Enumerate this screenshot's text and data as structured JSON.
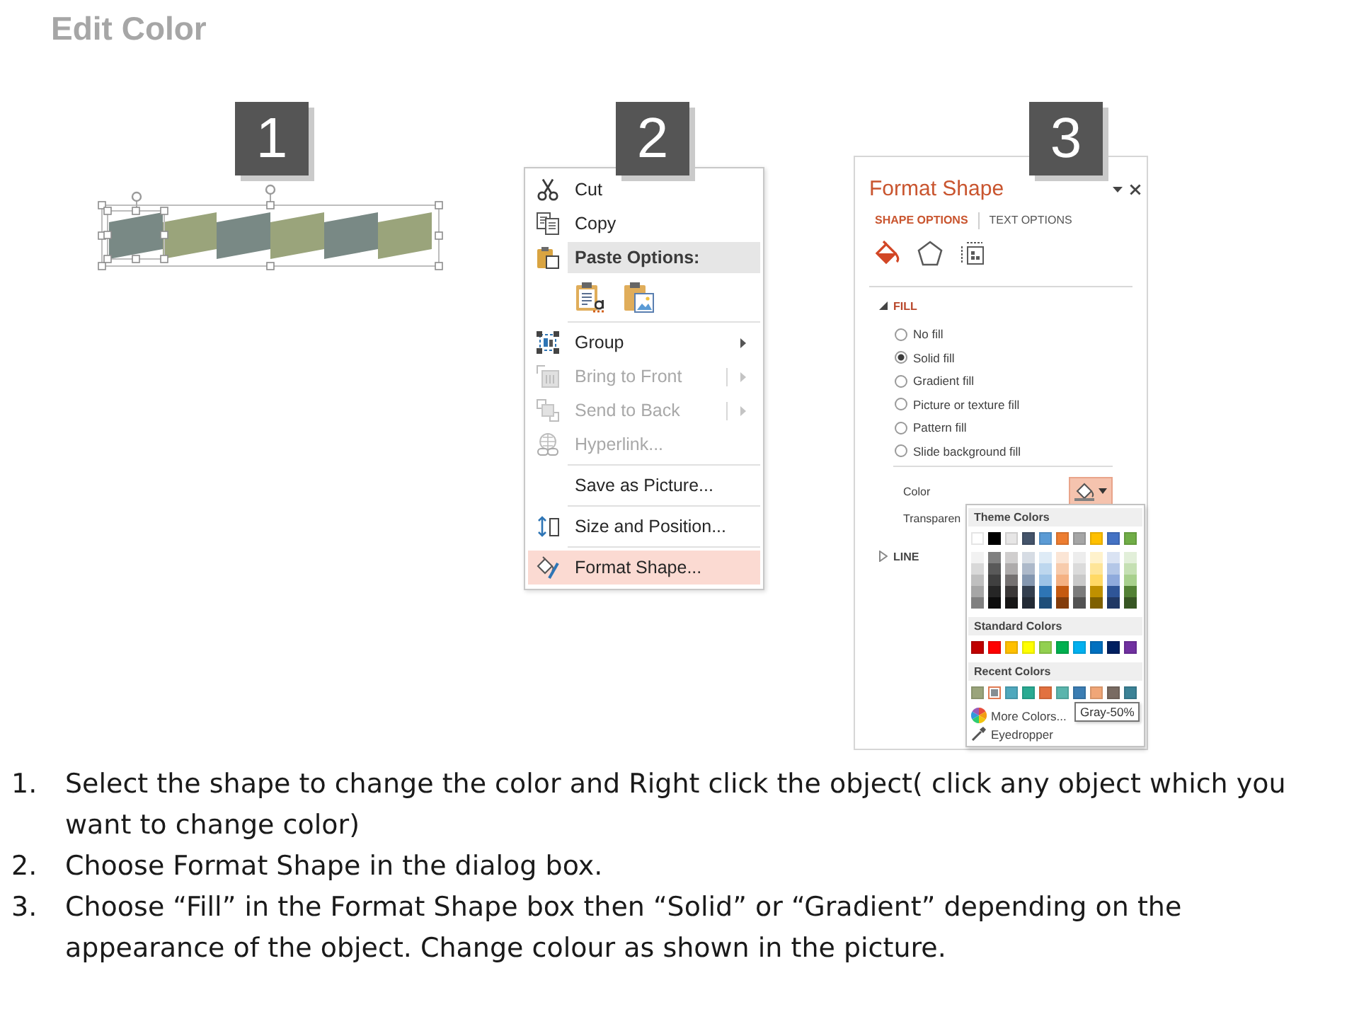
{
  "title": "Edit Color",
  "step_badges": [
    "1",
    "2",
    "3"
  ],
  "shape_group": {
    "selected": true,
    "shapes": [
      {
        "color": "#798985",
        "selected": true
      },
      {
        "color": "#9aa47b",
        "selected": false
      },
      {
        "color": "#798985",
        "selected": false
      },
      {
        "color": "#9aa47b",
        "selected": false
      },
      {
        "color": "#798985",
        "selected": false
      },
      {
        "color": "#9aa47b",
        "selected": false
      }
    ]
  },
  "context_menu": {
    "items": [
      {
        "kind": "command",
        "label": "Cut",
        "disabled": false,
        "submenu": false,
        "split": false,
        "selected": false
      },
      {
        "kind": "command",
        "label": "Copy",
        "disabled": false,
        "submenu": false,
        "split": false,
        "selected": false
      },
      {
        "kind": "header",
        "label": "Paste Options:"
      },
      {
        "kind": "paste_options",
        "options": [
          {
            "selected": false
          },
          {
            "selected": false
          }
        ]
      },
      {
        "kind": "separator"
      },
      {
        "kind": "command",
        "label": "Group",
        "disabled": false,
        "submenu": true,
        "split": false,
        "selected": false
      },
      {
        "kind": "command",
        "label": "Bring to Front",
        "disabled": true,
        "submenu": true,
        "split": true,
        "selected": false
      },
      {
        "kind": "command",
        "label": "Send to Back",
        "disabled": true,
        "submenu": true,
        "split": true,
        "selected": false
      },
      {
        "kind": "command",
        "label": "Hyperlink...",
        "disabled": true,
        "submenu": false,
        "split": false,
        "selected": false
      },
      {
        "kind": "separator"
      },
      {
        "kind": "command",
        "label": "Save as Picture...",
        "disabled": false,
        "submenu": false,
        "split": false,
        "selected": false
      },
      {
        "kind": "separator"
      },
      {
        "kind": "command",
        "label": "Size and Position...",
        "disabled": false,
        "submenu": false,
        "split": false,
        "selected": false
      },
      {
        "kind": "separator"
      },
      {
        "kind": "command",
        "label": "Format Shape...",
        "disabled": false,
        "submenu": false,
        "split": false,
        "selected": true
      }
    ]
  },
  "format_panel": {
    "title": "Format Shape",
    "tabs": [
      {
        "label": "SHAPE OPTIONS",
        "selected": true
      },
      {
        "label": "TEXT OPTIONS",
        "selected": false
      }
    ],
    "icon_tabs": [
      {
        "selected": true
      },
      {
        "selected": false
      },
      {
        "selected": false
      }
    ],
    "sections": [
      {
        "label": "FILL",
        "expanded": true,
        "options": [
          {
            "label": "No fill",
            "checked": false
          },
          {
            "label": "Solid fill",
            "checked": true
          },
          {
            "label": "Gradient fill",
            "checked": false
          },
          {
            "label": "Picture or texture fill",
            "checked": false
          },
          {
            "label": "Pattern fill",
            "checked": false
          },
          {
            "label": "Slide background fill",
            "checked": false
          }
        ],
        "color": {
          "label": "Color",
          "expanded": true
        },
        "transparency": {
          "label": "Transparen"
        }
      },
      {
        "label": "LINE",
        "expanded": false
      }
    ],
    "color_palette": {
      "groups": [
        {
          "title": "Theme Colors",
          "colors": [
            {
              "color": "#ffffff",
              "selected": false,
              "shades": [
                {
                  "color": "#f2f2f2",
                  "selected": false
                },
                {
                  "color": "#d9d9d9",
                  "selected": false
                },
                {
                  "color": "#bfbfbf",
                  "selected": false
                },
                {
                  "color": "#a6a6a6",
                  "selected": false
                },
                {
                  "color": "#808080",
                  "selected": false
                }
              ]
            },
            {
              "color": "#000000",
              "selected": false,
              "shades": [
                {
                  "color": "#7f7f7f",
                  "selected": false
                },
                {
                  "color": "#595959",
                  "selected": false
                },
                {
                  "color": "#404040",
                  "selected": false
                },
                {
                  "color": "#262626",
                  "selected": false
                },
                {
                  "color": "#0d0d0d",
                  "selected": false
                }
              ]
            },
            {
              "color": "#e7e6e6",
              "selected": false,
              "shades": [
                {
                  "color": "#d0cece",
                  "selected": false
                },
                {
                  "color": "#aeabab",
                  "selected": false
                },
                {
                  "color": "#757171",
                  "selected": false
                },
                {
                  "color": "#3b3838",
                  "selected": false
                },
                {
                  "color": "#171616",
                  "selected": false
                }
              ]
            },
            {
              "color": "#44546a",
              "selected": false,
              "shades": [
                {
                  "color": "#d6dce4",
                  "selected": false
                },
                {
                  "color": "#adb9ca",
                  "selected": false
                },
                {
                  "color": "#8497b0",
                  "selected": false
                },
                {
                  "color": "#333f4f",
                  "selected": false
                },
                {
                  "color": "#222a35",
                  "selected": false
                }
              ]
            },
            {
              "color": "#5b9bd5",
              "selected": false,
              "shades": [
                {
                  "color": "#deebf6",
                  "selected": false
                },
                {
                  "color": "#bdd7ee",
                  "selected": false
                },
                {
                  "color": "#9dc3e6",
                  "selected": false
                },
                {
                  "color": "#2e75b5",
                  "selected": false
                },
                {
                  "color": "#1e4e79",
                  "selected": false
                }
              ]
            },
            {
              "color": "#ed7d31",
              "selected": false,
              "shades": [
                {
                  "color": "#fbe5d5",
                  "selected": false
                },
                {
                  "color": "#f7cbac",
                  "selected": false
                },
                {
                  "color": "#f4b183",
                  "selected": false
                },
                {
                  "color": "#c55a11",
                  "selected": false
                },
                {
                  "color": "#833c0b",
                  "selected": false
                }
              ]
            },
            {
              "color": "#a5a5a5",
              "selected": false,
              "shades": [
                {
                  "color": "#ededed",
                  "selected": false
                },
                {
                  "color": "#dbdbdb",
                  "selected": false
                },
                {
                  "color": "#c9c9c9",
                  "selected": false
                },
                {
                  "color": "#7b7b7b",
                  "selected": false
                },
                {
                  "color": "#525252",
                  "selected": false
                }
              ]
            },
            {
              "color": "#ffc000",
              "selected": false,
              "shades": [
                {
                  "color": "#fff2cc",
                  "selected": false
                },
                {
                  "color": "#fee599",
                  "selected": false
                },
                {
                  "color": "#ffd965",
                  "selected": false
                },
                {
                  "color": "#bf9000",
                  "selected": false
                },
                {
                  "color": "#7f6000",
                  "selected": false
                }
              ]
            },
            {
              "color": "#4472c4",
              "selected": false,
              "shades": [
                {
                  "color": "#dae3f3",
                  "selected": false
                },
                {
                  "color": "#b4c7e7",
                  "selected": false
                },
                {
                  "color": "#8faadc",
                  "selected": false
                },
                {
                  "color": "#2f5597",
                  "selected": false
                },
                {
                  "color": "#203864",
                  "selected": false
                }
              ]
            },
            {
              "color": "#70ad47",
              "selected": false,
              "shades": [
                {
                  "color": "#e2efd9",
                  "selected": false
                },
                {
                  "color": "#c5e0b3",
                  "selected": false
                },
                {
                  "color": "#a8d08d",
                  "selected": false
                },
                {
                  "color": "#538135",
                  "selected": false
                },
                {
                  "color": "#375623",
                  "selected": false
                }
              ]
            }
          ]
        },
        {
          "title": "Standard Colors",
          "colors": [
            {
              "color": "#c00000",
              "selected": false
            },
            {
              "color": "#ff0000",
              "selected": false
            },
            {
              "color": "#ffc000",
              "selected": false
            },
            {
              "color": "#ffff00",
              "selected": false
            },
            {
              "color": "#92d050",
              "selected": false
            },
            {
              "color": "#00b050",
              "selected": false
            },
            {
              "color": "#00b0f0",
              "selected": false
            },
            {
              "color": "#0070c0",
              "selected": false
            },
            {
              "color": "#002060",
              "selected": false
            },
            {
              "color": "#7030a0",
              "selected": false
            }
          ]
        },
        {
          "title": "Recent Colors",
          "colors": [
            {
              "color": "#9aa47b",
              "selected": false
            },
            {
              "color": "#868e92",
              "selected": true
            },
            {
              "color": "#4fa8bd",
              "selected": false
            },
            {
              "color": "#2aaa92",
              "selected": false
            },
            {
              "color": "#e2713f",
              "selected": false
            },
            {
              "color": "#5ab5ad",
              "selected": false
            },
            {
              "color": "#3b7db3",
              "selected": false
            },
            {
              "color": "#f0a677",
              "selected": false
            },
            {
              "color": "#796b62",
              "selected": false
            },
            {
              "color": "#3b8296",
              "selected": false
            }
          ]
        }
      ],
      "commands": [
        {
          "label": "More Colors..."
        },
        {
          "label": "Eyedropper"
        }
      ],
      "tooltip": "Gray-50%"
    }
  },
  "instructions": [
    {
      "number": "1.",
      "text": "Select the shape to change the color and Right click the object( click any object which you want to change color)"
    },
    {
      "number": "2.",
      "text": "Choose Format Shape in the dialog box."
    },
    {
      "number": "3.",
      "text": "Choose “Fill” in the Format Shape box then “Solid” or “Gradient” depending on the appearance of the object. Change colour as shown in the picture."
    }
  ]
}
